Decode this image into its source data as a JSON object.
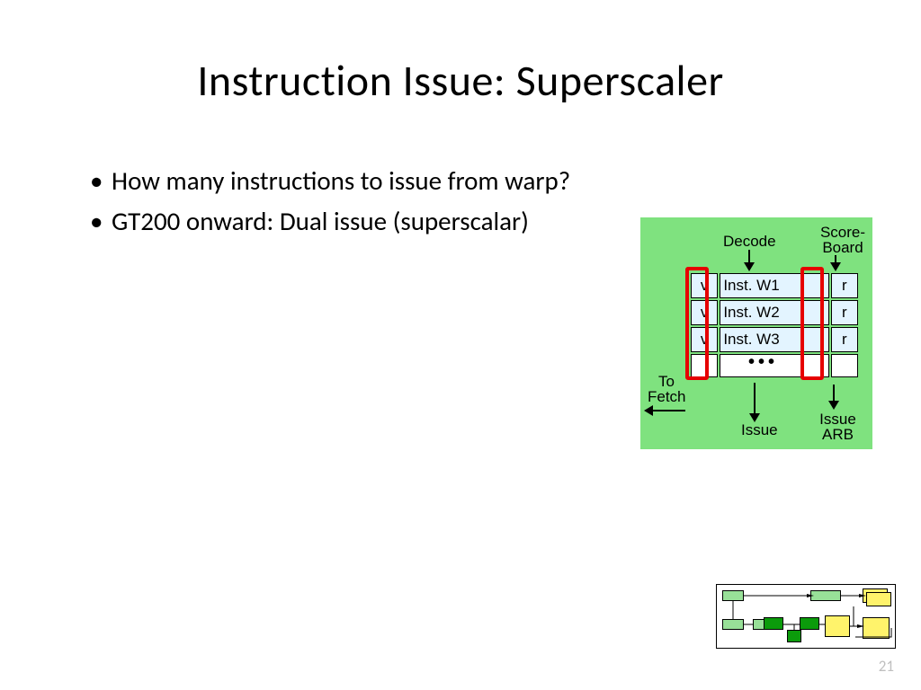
{
  "title": "Instruction Issue: Superscaler",
  "bullets": [
    "How many instructions to issue from warp?",
    "GT200 onward: Dual issue (superscalar)"
  ],
  "page_number": "21",
  "diagram": {
    "labels": {
      "decode": "Decode",
      "scoreboard": "Score-\nBoard",
      "to_fetch": "To\nFetch",
      "issue": "Issue",
      "issue_arb": "Issue\nARB"
    },
    "rows": [
      {
        "v": "v",
        "inst": "Inst. W1",
        "r": "r"
      },
      {
        "v": "v",
        "inst": "Inst. W2",
        "r": "r"
      },
      {
        "v": "v",
        "inst": "Inst. W3",
        "r": "r"
      }
    ]
  }
}
